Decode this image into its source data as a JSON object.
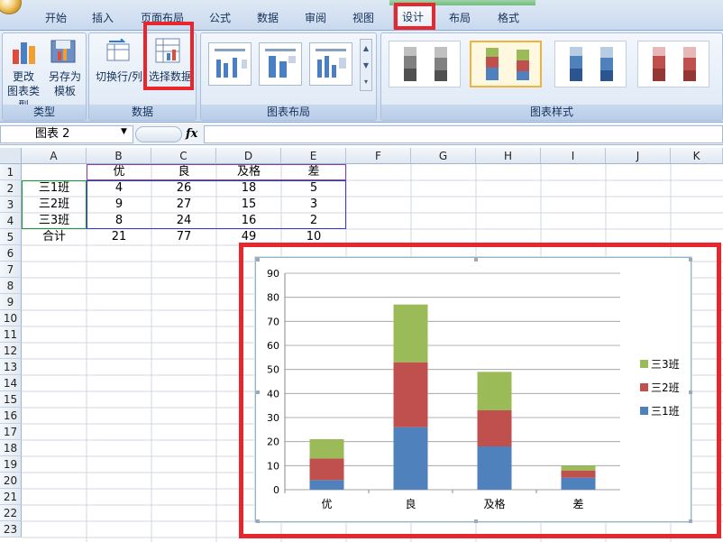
{
  "ribbon": {
    "tabs": [
      "开始",
      "插入",
      "页面布局",
      "公式",
      "数据",
      "审阅",
      "视图",
      "设计",
      "布局",
      "格式"
    ],
    "buttons": {
      "change_type": [
        "更改",
        "图表类型"
      ],
      "save_template": [
        "另存为",
        "模板"
      ],
      "switch_row_col": "切换行/列",
      "select_data": "选择数据"
    },
    "groups": [
      "类型",
      "数据",
      "图表布局",
      "图表样式"
    ]
  },
  "formula_bar": {
    "name_box": "图表 2",
    "fx": "fx"
  },
  "sheet": {
    "columns": [
      "A",
      "B",
      "C",
      "D",
      "E",
      "F",
      "G",
      "H",
      "I",
      "J",
      "K"
    ],
    "rows": [
      "1",
      "2",
      "3",
      "4",
      "5",
      "6",
      "7",
      "8",
      "9",
      "10",
      "11",
      "12",
      "13",
      "14",
      "15",
      "16",
      "17",
      "18",
      "19",
      "20",
      "21",
      "22",
      "23"
    ],
    "table": [
      [
        "",
        "优",
        "良",
        "及格",
        "差"
      ],
      [
        "三1班",
        "4",
        "26",
        "18",
        "5"
      ],
      [
        "三2班",
        "9",
        "27",
        "15",
        "3"
      ],
      [
        "三3班",
        "8",
        "24",
        "16",
        "2"
      ],
      [
        "合计",
        "21",
        "77",
        "49",
        "10"
      ]
    ]
  },
  "chart_data": {
    "type": "bar",
    "stacked": true,
    "categories": [
      "优",
      "良",
      "及格",
      "差"
    ],
    "series": [
      {
        "name": "三1班",
        "values": [
          4,
          26,
          18,
          5
        ],
        "color": "#4f81bd"
      },
      {
        "name": "三2班",
        "values": [
          9,
          27,
          15,
          3
        ],
        "color": "#c0504d"
      },
      {
        "name": "三3班",
        "values": [
          8,
          24,
          16,
          2
        ],
        "color": "#9bbb59"
      }
    ],
    "ylim": [
      0,
      90
    ],
    "yticks": [
      "0",
      "10",
      "20",
      "30",
      "40",
      "50",
      "60",
      "70",
      "80",
      "90"
    ],
    "grid": true,
    "legend": "right"
  }
}
